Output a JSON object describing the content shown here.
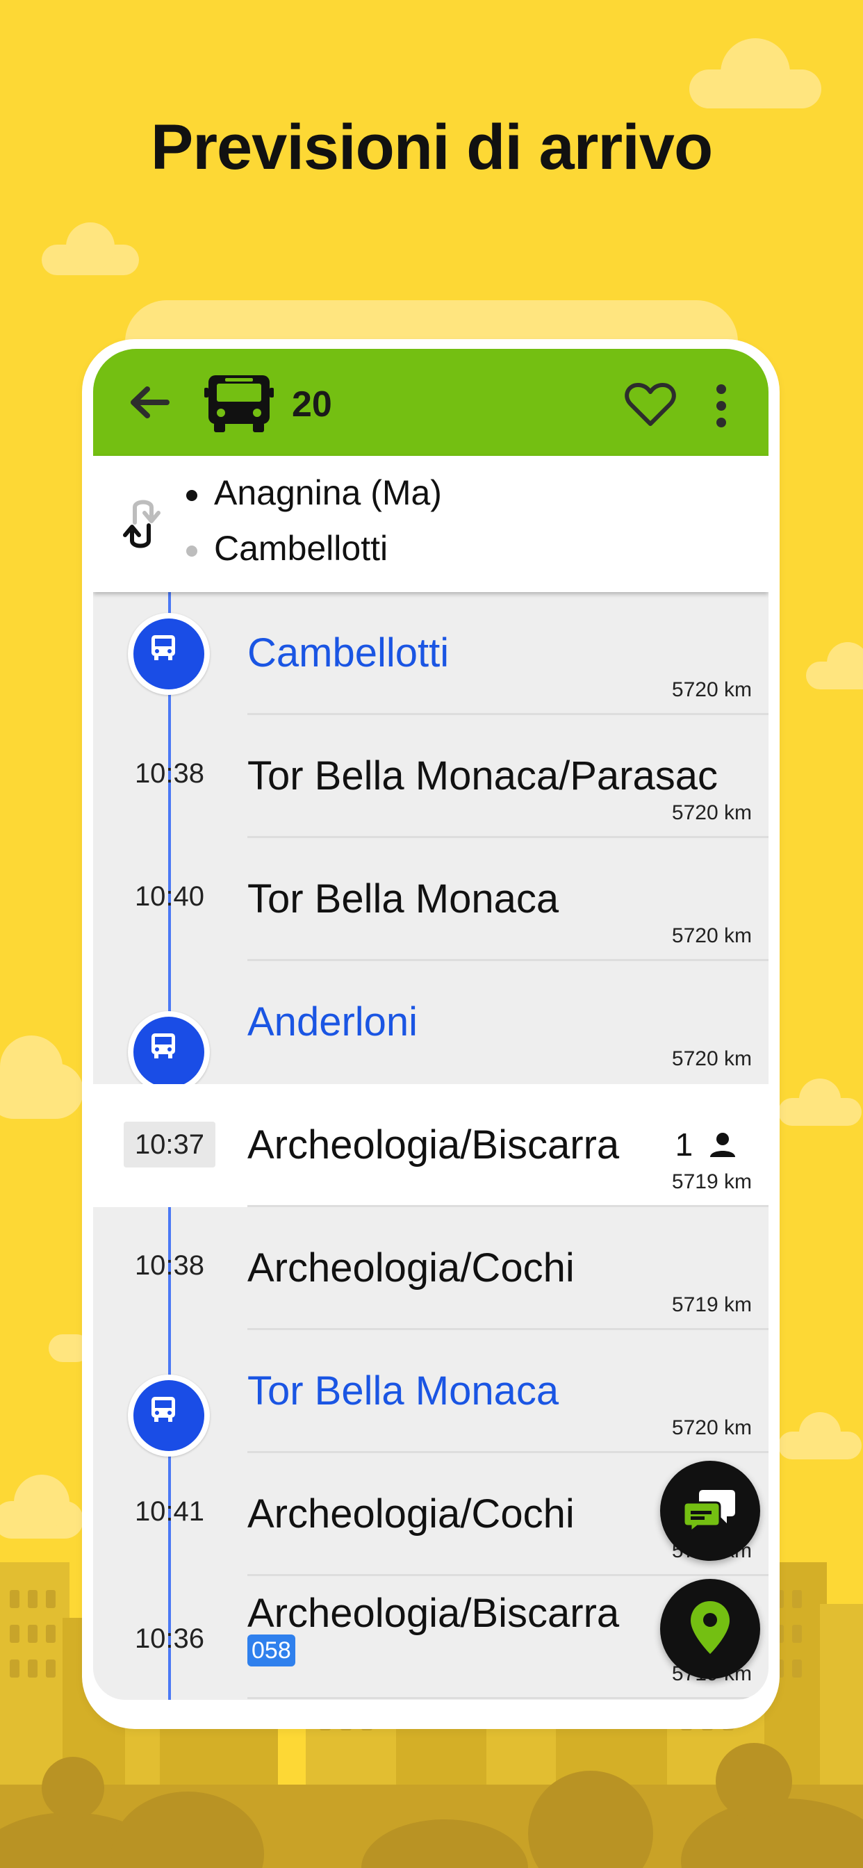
{
  "headline": "Previsioni di arrivo",
  "appbar": {
    "route_number": "20",
    "back_icon": "arrow-left-icon",
    "bus_icon": "bus-icon",
    "favorite_icon": "heart-outline-icon",
    "menu_icon": "more-vertical-icon"
  },
  "directions": {
    "swap_icon": "swap-direction-icon",
    "items": [
      {
        "label": "Anagnina (Ma)",
        "active": true
      },
      {
        "label": "Cambellotti",
        "active": false
      }
    ]
  },
  "stops": [
    {
      "type": "bus",
      "name": "Cambellotti",
      "distance": "5720 km"
    },
    {
      "type": "stop",
      "time": "10:38",
      "name": "Tor Bella Monaca/Parasac",
      "distance": "5720 km"
    },
    {
      "type": "stop",
      "time": "10:40",
      "name": "Tor Bella Monaca",
      "distance": "5720 km"
    },
    {
      "type": "bus",
      "name": "Anderloni",
      "distance": "5720 km"
    },
    {
      "type": "stop",
      "time": "10:37",
      "name": "Archeologia/Biscarra",
      "distance": "5719 km",
      "selected": true,
      "occupancy": "1"
    },
    {
      "type": "stop",
      "time": "10:38",
      "name": "Archeologia/Cochi",
      "distance": "5719 km"
    },
    {
      "type": "bus",
      "name": "Tor Bella Monaca",
      "distance": "5720 km"
    },
    {
      "type": "stop",
      "time": "10:41",
      "name": "Archeologia/Cochi",
      "distance": "5719 km"
    },
    {
      "type": "stop",
      "time": "10:36",
      "name": "Archeologia/Biscarra",
      "distance": "5719 km",
      "badge": "058"
    }
  ],
  "fabs": {
    "chat_icon": "chat-bubbles-icon",
    "map_icon": "map-pin-icon"
  },
  "colors": {
    "background": "#FDD835",
    "appbar": "#74BF12",
    "accent_blue": "#1A4DE6",
    "stop_name_blue": "#1A55E3",
    "fab": "#111111",
    "fab_icon": "#74BF12"
  }
}
